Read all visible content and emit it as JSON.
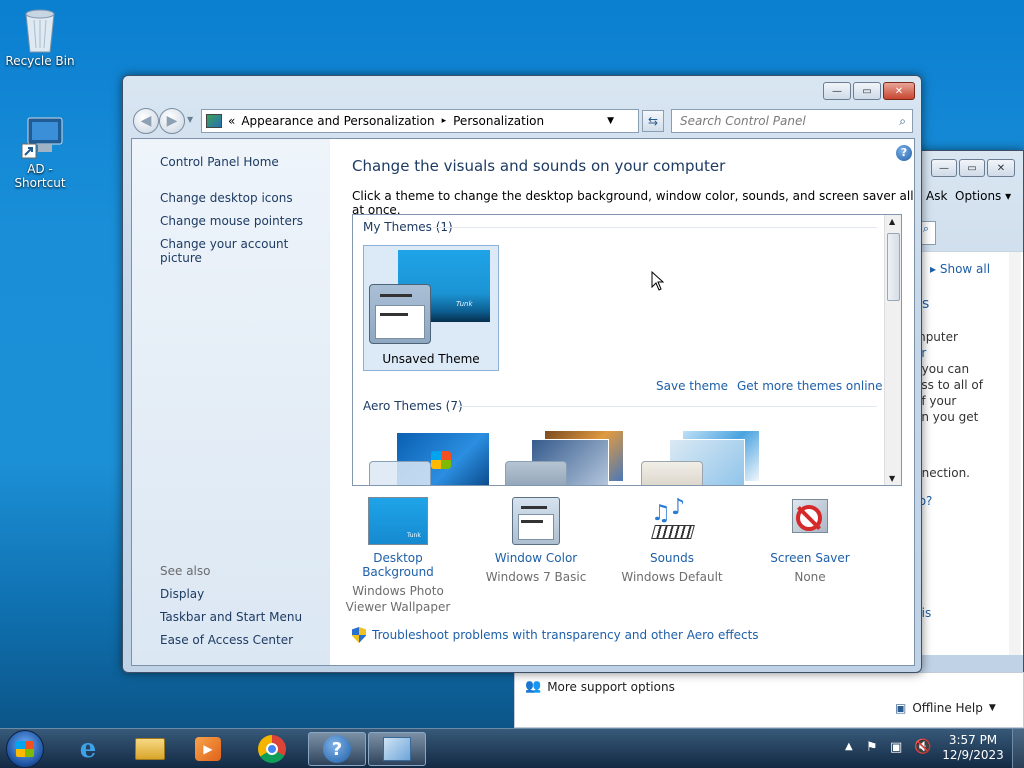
{
  "desktop": {
    "icons": [
      {
        "label": "Recycle Bin"
      },
      {
        "label": "AD - Shortcut"
      }
    ]
  },
  "bg_window": {
    "menu": {
      "ask": "Ask",
      "options": "Options"
    },
    "show_all": "Show all",
    "text_fragments": [
      "s",
      "mputer",
      "er",
      ", you can",
      "ess to all of",
      "of your",
      "en you get",
      "e",
      "nnection.",
      "to?",
      "his"
    ],
    "more_support": "More support options",
    "offline_help": "Offline Help"
  },
  "window": {
    "address": {
      "chevron": "«",
      "crumbs": [
        "Appearance and Personalization",
        "Personalization"
      ],
      "separator": "▸"
    },
    "search": {
      "placeholder": "Search Control Panel"
    },
    "left_pane": {
      "home": "Control Panel Home",
      "links": [
        "Change desktop icons",
        "Change mouse pointers",
        "Change your account picture"
      ],
      "see_also_title": "See also",
      "see_also": [
        "Display",
        "Taskbar and Start Menu",
        "Ease of Access Center"
      ]
    },
    "main": {
      "title": "Change the visuals and sounds on your computer",
      "description": "Click a theme to change the desktop background, window color, sounds, and screen saver all at once.",
      "my_themes_label": "My Themes (1)",
      "unsaved_theme": "Unsaved Theme",
      "save_theme": "Save theme",
      "get_more": "Get more themes online",
      "aero_label": "Aero Themes (7)",
      "preview_logo": "Tunk",
      "tiles": [
        {
          "label": "Desktop Background",
          "sub": "Windows Photo Viewer Wallpaper"
        },
        {
          "label": "Window Color",
          "sub": "Windows 7 Basic"
        },
        {
          "label": "Sounds",
          "sub": "Windows Default"
        },
        {
          "label": "Screen Saver",
          "sub": "None"
        }
      ],
      "troubleshoot": "Troubleshoot problems with transparency and other Aero effects"
    }
  },
  "taskbar": {
    "time": "3:57 PM",
    "date": "12/9/2023"
  },
  "colors": {
    "desktop": "#1a8fd8",
    "link": "#1e5fa8",
    "heading": "#1e3b63"
  }
}
